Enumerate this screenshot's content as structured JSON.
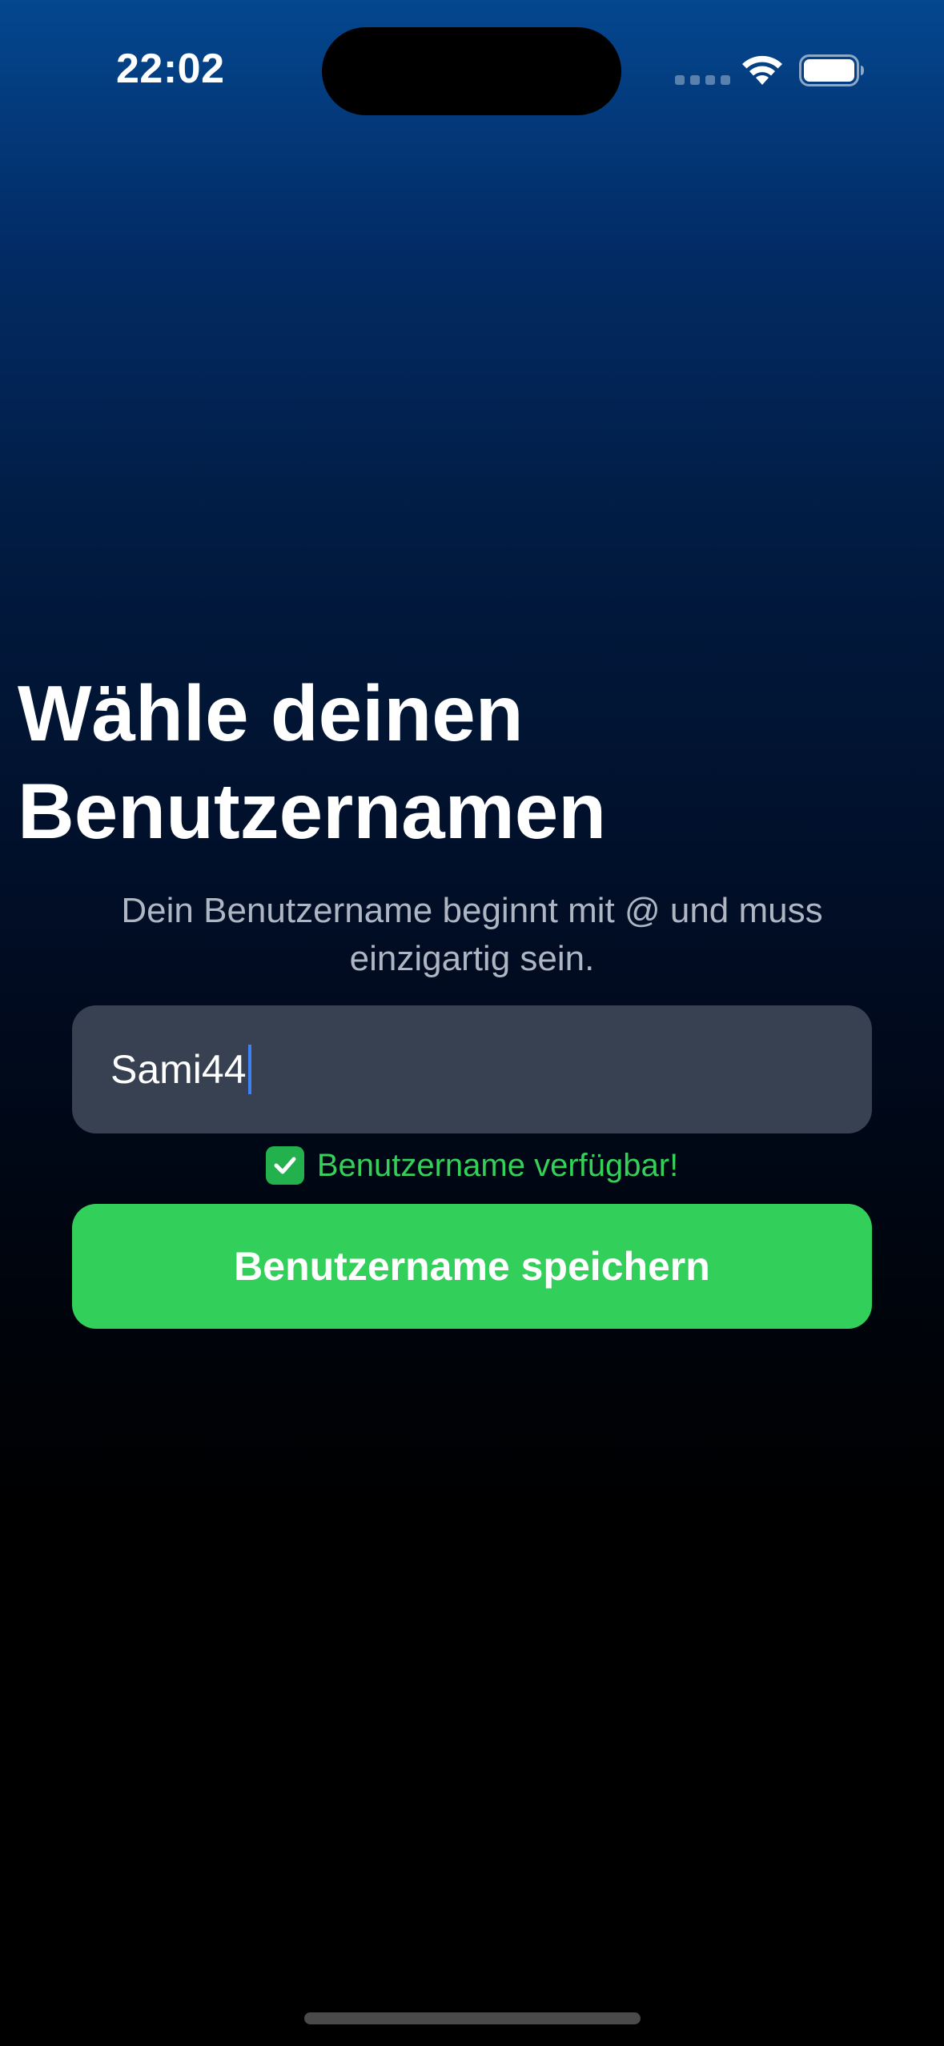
{
  "status_bar": {
    "time": "22:02",
    "icons": [
      "cellular-signal-icon",
      "wifi-icon",
      "battery-icon"
    ]
  },
  "main": {
    "title": "Wähle deinen Benutzernamen",
    "subtitle": "Dein Benutzername beginnt mit @ und muss einzigartig sein.",
    "username_input": {
      "value": "Sami44"
    },
    "availability": {
      "icon": "check-icon",
      "text": "Benutzername verfügbar!"
    },
    "save_button_label": "Benutzername speichern"
  },
  "colors": {
    "accent_green": "#32d05a",
    "availability_green": "#34d058",
    "input_background": "#374151",
    "cursor_blue": "#3b82f6",
    "background_top": "#04478f",
    "background_bottom": "#000000"
  }
}
